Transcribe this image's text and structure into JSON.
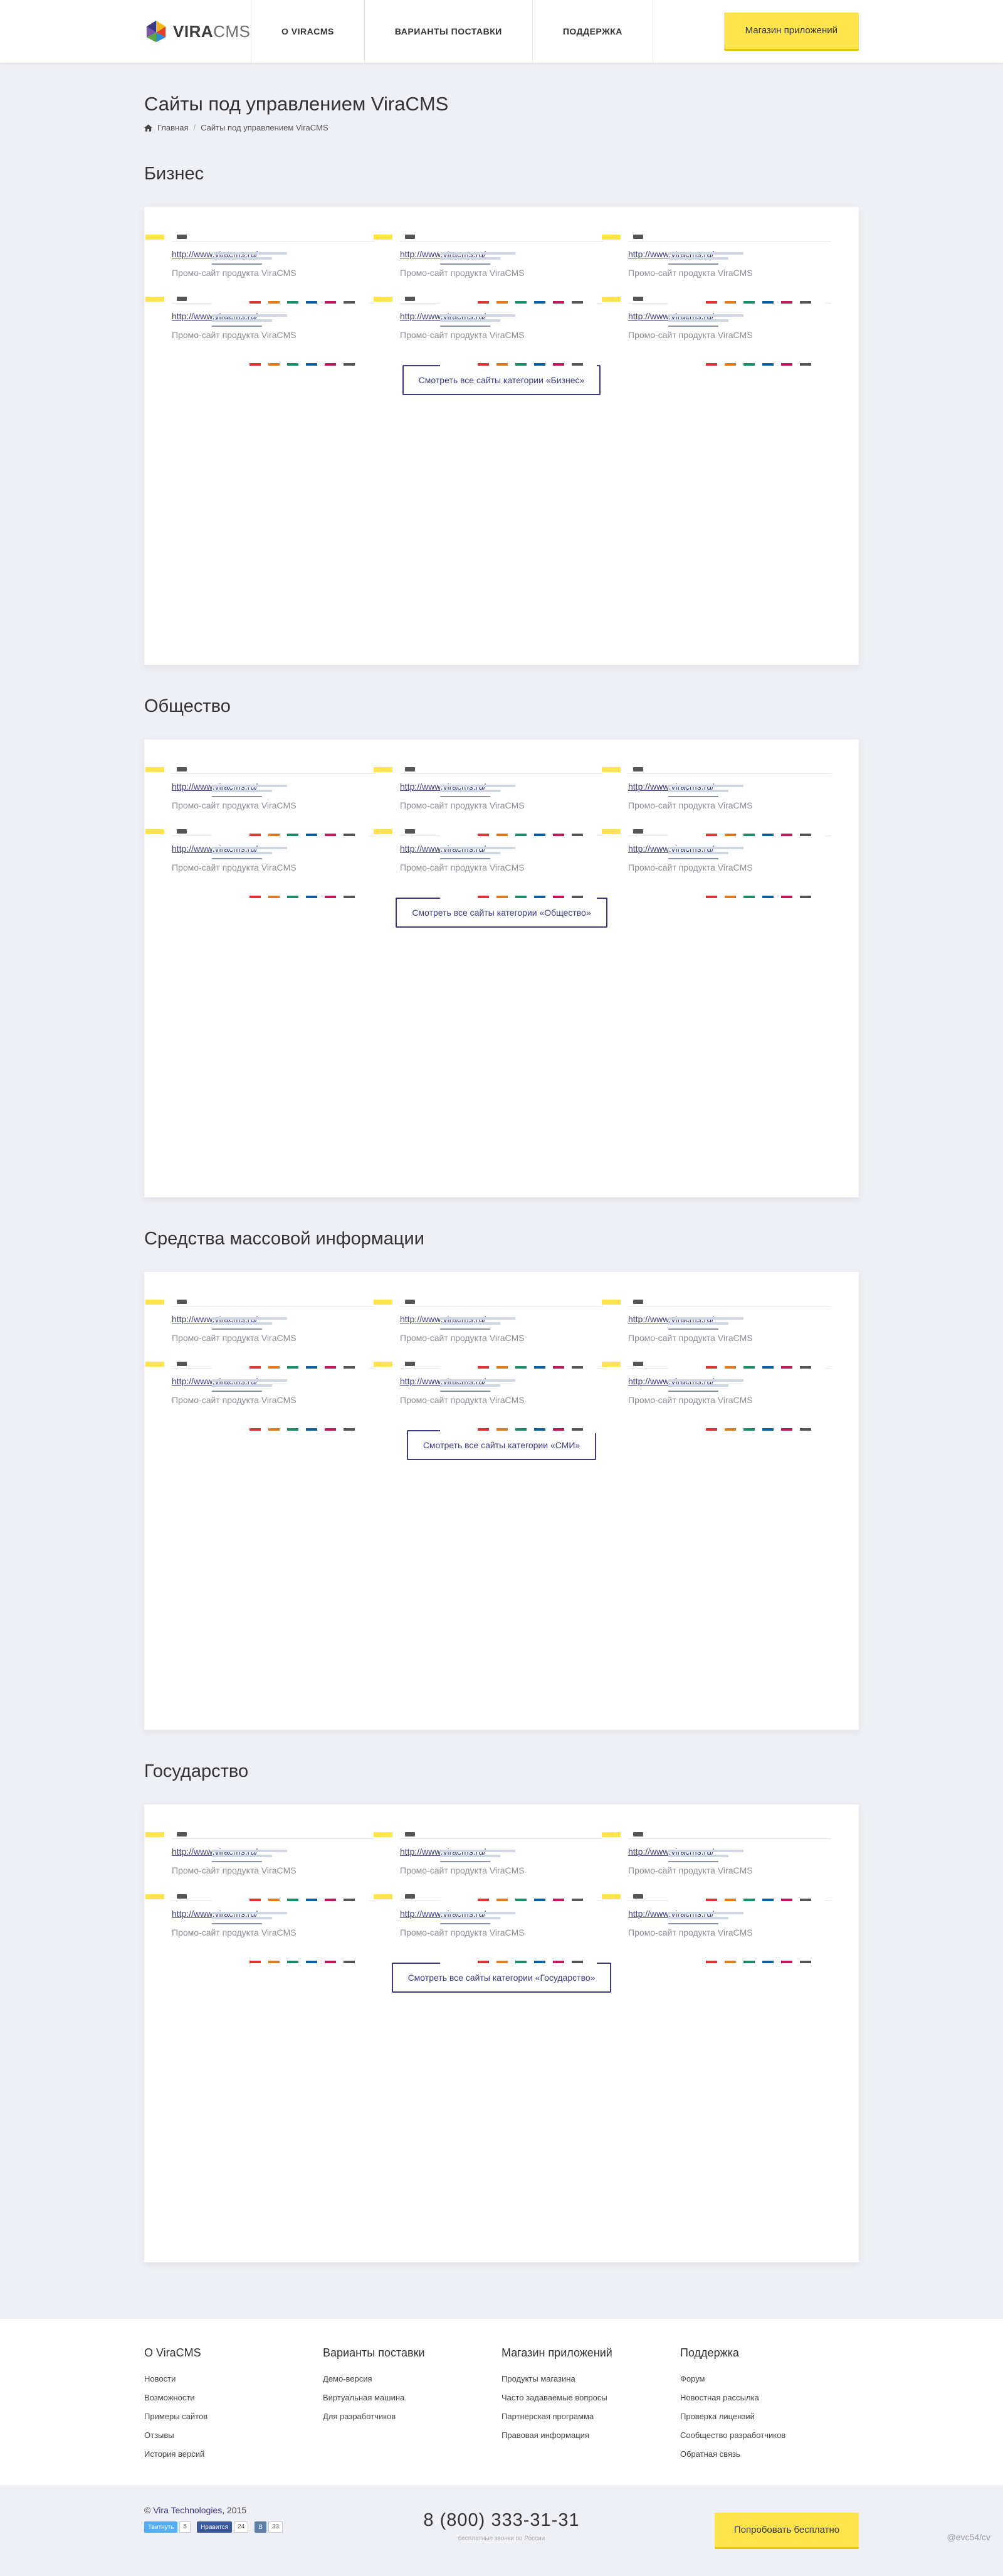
{
  "header": {
    "logo_text_bold": "VIRA",
    "logo_text_light": "CMS",
    "nav": [
      {
        "label": "О VIRACMS"
      },
      {
        "label": "ВАРИАНТЫ ПОСТАВКИ"
      },
      {
        "label": "ПОДДЕРЖКА"
      }
    ],
    "store_button": "Магазин приложений"
  },
  "page": {
    "title": "Сайты под управлением ViraCMS",
    "breadcrumb": {
      "home": "Главная",
      "current": "Сайты под управлением ViraCMS"
    }
  },
  "sections": [
    {
      "title": "Бизнес",
      "items": [
        {
          "url": "http://www.viracms.ru/",
          "desc": "Промо-сайт продукта ViraCMS"
        },
        {
          "url": "http://www.viracms.ru/",
          "desc": "Промо-сайт продукта ViraCMS"
        },
        {
          "url": "http://www.viracms.ru/",
          "desc": "Промо-сайт продукта ViraCMS"
        },
        {
          "url": "http://www.viracms.ru/",
          "desc": "Промо-сайт продукта ViraCMS"
        },
        {
          "url": "http://www.viracms.ru/",
          "desc": "Промо-сайт продукта ViraCMS"
        },
        {
          "url": "http://www.viracms.ru/",
          "desc": "Промо-сайт продукта ViraCMS"
        }
      ],
      "more_label": "Смотреть все сайты категории «Бизнес»"
    },
    {
      "title": "Общество",
      "items": [
        {
          "url": "http://www.viracms.ru/",
          "desc": "Промо-сайт продукта ViraCMS"
        },
        {
          "url": "http://www.viracms.ru/",
          "desc": "Промо-сайт продукта ViraCMS"
        },
        {
          "url": "http://www.viracms.ru/",
          "desc": "Промо-сайт продукта ViraCMS"
        },
        {
          "url": "http://www.viracms.ru/",
          "desc": "Промо-сайт продукта ViraCMS"
        },
        {
          "url": "http://www.viracms.ru/",
          "desc": "Промо-сайт продукта ViraCMS"
        },
        {
          "url": "http://www.viracms.ru/",
          "desc": "Промо-сайт продукта ViraCMS"
        }
      ],
      "more_label": "Смотреть все сайты категории «Общество»"
    },
    {
      "title": "Средства массовой информации",
      "items": [
        {
          "url": "http://www.viracms.ru/",
          "desc": "Промо-сайт продукта ViraCMS"
        },
        {
          "url": "http://www.viracms.ru/",
          "desc": "Промо-сайт продукта ViraCMS"
        },
        {
          "url": "http://www.viracms.ru/",
          "desc": "Промо-сайт продукта ViraCMS"
        },
        {
          "url": "http://www.viracms.ru/",
          "desc": "Промо-сайт продукта ViraCMS"
        },
        {
          "url": "http://www.viracms.ru/",
          "desc": "Промо-сайт продукта ViraCMS"
        },
        {
          "url": "http://www.viracms.ru/",
          "desc": "Промо-сайт продукта ViraCMS"
        }
      ],
      "more_label": "Смотреть все сайты категории «СМИ»"
    },
    {
      "title": "Государство",
      "items": [
        {
          "url": "http://www.viracms.ru/",
          "desc": "Промо-сайт продукта ViraCMS"
        },
        {
          "url": "http://www.viracms.ru/",
          "desc": "Промо-сайт продукта ViraCMS"
        },
        {
          "url": "http://www.viracms.ru/",
          "desc": "Промо-сайт продукта ViraCMS"
        },
        {
          "url": "http://www.viracms.ru/",
          "desc": "Промо-сайт продукта ViraCMS"
        },
        {
          "url": "http://www.viracms.ru/",
          "desc": "Промо-сайт продукта ViraCMS"
        },
        {
          "url": "http://www.viracms.ru/",
          "desc": "Промо-сайт продукта ViraCMS"
        }
      ],
      "more_label": "Смотреть все сайты категории «Государство»"
    }
  ],
  "footer": {
    "columns": [
      {
        "title": "О ViraCMS",
        "links": [
          "Новости",
          "Возможности",
          "Примеры сайтов",
          "Отзывы",
          "История версий"
        ]
      },
      {
        "title": "Варианты поставки",
        "links": [
          "Демо-версия",
          "Виртуальная машина",
          "Для разработчиков"
        ]
      },
      {
        "title": "Магазин приложений",
        "links": [
          "Продукты магазина",
          "Часто задаваемые вопросы",
          "Партнерская программа",
          "Правовая информация"
        ]
      },
      {
        "title": "Поддержка",
        "links": [
          "Форум",
          "Новостная рассылка",
          "Проверка лицензий",
          "Сообщество разработчиков",
          "Обратная связь"
        ]
      }
    ],
    "copyright_prefix": "©",
    "copyright_brand": "Vira Technologies",
    "copyright_year": ", 2015",
    "social": [
      {
        "label": "Твитнуть",
        "count": "5",
        "color": "#55acee"
      },
      {
        "label": "Нравится",
        "count": "24",
        "color": "#3b5998"
      },
      {
        "label": "В",
        "count": "33",
        "color": "#5b7fa6"
      }
    ],
    "phone": "8 (800) 333-31-31",
    "phone_note": "бесплатные звонки по России",
    "try_button": "Попробовать бесплатно",
    "credit": "@evc54/cv"
  },
  "colors": {
    "accent_yellow": "#ffe44d",
    "link_indigo": "#3b3a85",
    "page_bg": "#eff0f5"
  }
}
